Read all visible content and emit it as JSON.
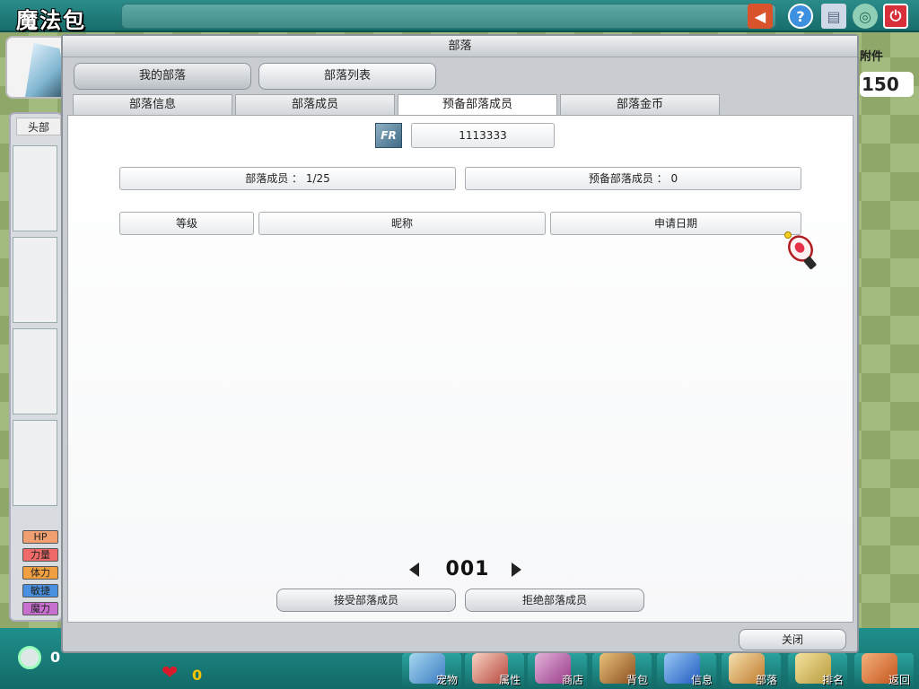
{
  "app": {
    "title": "魔法包"
  },
  "background": {
    "left_tab": "头部",
    "stats": [
      "HP",
      "力量",
      "体力",
      "敏捷",
      "魔力"
    ],
    "right_label": "附件",
    "right_number": "150",
    "coin_count": "0",
    "heart_count": "0"
  },
  "bottom_nav": [
    {
      "label": "宠物",
      "icon": "pet-icon"
    },
    {
      "label": "属性",
      "icon": "attribute-icon"
    },
    {
      "label": "商店",
      "icon": "shop-icon"
    },
    {
      "label": "背包",
      "icon": "bag-icon"
    },
    {
      "label": "信息",
      "icon": "info-icon"
    },
    {
      "label": "部落",
      "icon": "tribe-icon"
    },
    {
      "label": "排名",
      "icon": "rank-icon"
    },
    {
      "label": "返回",
      "icon": "return-icon"
    }
  ],
  "dialog": {
    "title": "部落",
    "main_tabs": [
      "我的部落",
      "部落列表"
    ],
    "sub_tabs": [
      "部落信息",
      "部落成员",
      "预备部落成员",
      "部落金币"
    ],
    "active_sub_tab": "预备部落成员",
    "tribe_id": "1113333",
    "emblem_text": "FR",
    "member_count": "部落成员 ： 1/25",
    "pending_count": "预备部落成员 ： 0",
    "columns": [
      "等级",
      "昵称",
      "申请日期"
    ],
    "page": "001",
    "accept_label": "接受部落成员",
    "reject_label": "拒绝部落成员",
    "close_label": "关闭"
  },
  "colors": {
    "accent": "#1f8f8b",
    "hp": "#f0a070",
    "strength": "#f06a6a",
    "stamina": "#f0a040",
    "agility": "#4a90e0",
    "magic": "#c870d0"
  }
}
